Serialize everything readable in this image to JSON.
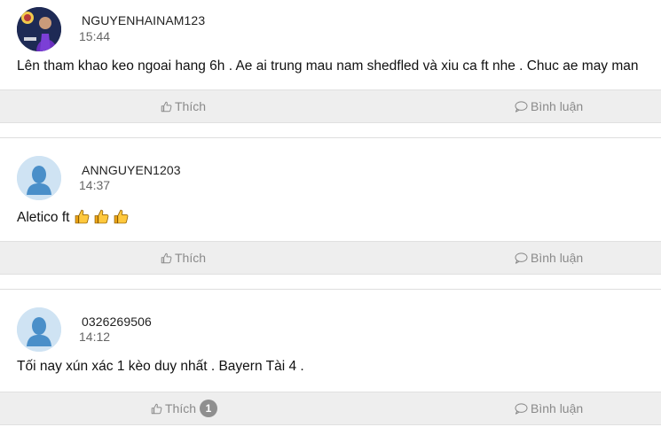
{
  "posts": [
    {
      "username": "NGUYENHAINAM123",
      "time": "15:44",
      "avatar": "user-photo",
      "content": "Lên tham khao keo ngoai hang 6h . Ae ai trung mau nam shedfled và xiu ca ft nhe . Chuc ae may man",
      "like_label": "Thích",
      "like_count": "",
      "comment_label": "Bình luận"
    },
    {
      "username": "ANNGUYEN1203",
      "time": "14:37",
      "avatar": "default-user",
      "content": "Aletico ft",
      "emojis": [
        "thumbs-up-emoji",
        "thumbs-up-emoji",
        "thumbs-up-emoji"
      ],
      "like_label": "Thích",
      "like_count": "",
      "comment_label": "Bình luận"
    },
    {
      "username": "0326269506",
      "time": "14:12",
      "avatar": "default-user",
      "content": "Tối nay xún xác 1 kèo duy nhất . Bayern Tài 4 .",
      "like_label": "Thích",
      "like_count": "1",
      "comment_label": "Bình luận"
    }
  ],
  "colors": {
    "action_bar_bg": "#eeeeee",
    "action_text": "#8a8a8a",
    "badge_bg": "#8f8f8f",
    "avatar_default_bg": "#cfe3f3",
    "avatar_silhouette": "#4a8fc9"
  },
  "icons": {
    "like": "thumbs-up-outline-icon",
    "comment": "speech-bubble-outline-icon"
  }
}
